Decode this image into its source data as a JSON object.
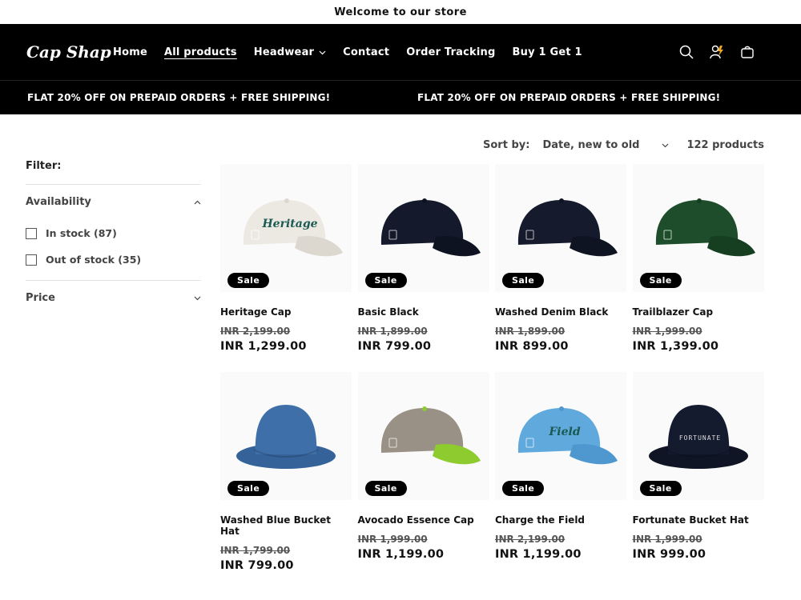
{
  "announcement": "Welcome to our store",
  "header": {
    "logo": "Cap Shap",
    "nav": [
      {
        "label": "Home"
      },
      {
        "label": "All products"
      },
      {
        "label": "Headwear"
      },
      {
        "label": "Contact"
      },
      {
        "label": "Order Tracking"
      },
      {
        "label": "Buy 1 Get 1"
      }
    ],
    "icons": [
      "search-icon",
      "account-icon",
      "cart-icon"
    ]
  },
  "promo": {
    "left": "FLAT 20% OFF ON PREPAID ORDERS + FREE SHIPPING!",
    "right": "FLAT 20% OFF ON PREPAID ORDERS + FREE SHIPPING!"
  },
  "filters": {
    "title": "Filter:",
    "availability": {
      "label": "Availability",
      "options": [
        {
          "label": "In stock (87)"
        },
        {
          "label": "Out of stock (35)"
        }
      ]
    },
    "price": {
      "label": "Price"
    }
  },
  "sort": {
    "label": "Sort by:",
    "value": "Date, new to old",
    "count": "122 products"
  },
  "products": [
    {
      "title": "Heritage Cap",
      "old_price": "INR 2,199.00",
      "price": "INR 1,299.00",
      "badge": "Sale",
      "color": "#ece9e3",
      "brim": "#dcd8d0",
      "logo": "Heritage"
    },
    {
      "title": "Basic Black",
      "old_price": "INR 1,899.00",
      "price": "INR 799.00",
      "badge": "Sale",
      "color": "#141a2b",
      "brim": "#0e1322",
      "logo": ""
    },
    {
      "title": "Washed Denim Black",
      "old_price": "INR 1,899.00",
      "price": "INR 899.00",
      "badge": "Sale",
      "color": "#151b2c",
      "brim": "#0f1422",
      "logo": ""
    },
    {
      "title": "Trailblazer Cap",
      "old_price": "INR 1,999.00",
      "price": "INR 1,399.00",
      "badge": "Sale",
      "color": "#1d4d2a",
      "brim": "#163e21",
      "logo": ""
    },
    {
      "title": "Washed Blue Bucket Hat",
      "old_price": "INR 1,799.00",
      "price": "INR 799.00",
      "badge": "Sale",
      "color": "#3f6fa8",
      "brim": "#36629a",
      "logo": ""
    },
    {
      "title": "Avocado Essence Cap",
      "old_price": "INR 1,999.00",
      "price": "INR 1,199.00",
      "badge": "Sale",
      "color": "#9a9186",
      "brim": "#8ecb2f",
      "logo": ""
    },
    {
      "title": "Charge the Field",
      "old_price": "INR 2,199.00",
      "price": "INR 1,199.00",
      "badge": "Sale",
      "color": "#5fa9dd",
      "brim": "#4f98cf",
      "logo": "Field"
    },
    {
      "title": "Fortunate Bucket Hat",
      "old_price": "INR 1,999.00",
      "price": "INR 999.00",
      "badge": "Sale",
      "color": "#141b2e",
      "brim": "#0f1525",
      "logo": "FORTUNATE"
    }
  ]
}
